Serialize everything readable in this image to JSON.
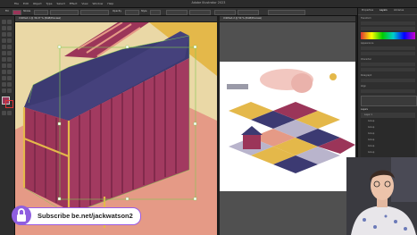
{
  "app": {
    "window_title": "Adobe Illustrator 2023",
    "menus": [
      "File",
      "Edit",
      "Object",
      "Type",
      "Select",
      "Effect",
      "View",
      "Window",
      "Help"
    ]
  },
  "documents": [
    {
      "tab": "Untitled-1 @ 39.27 % (RGB/Preview)"
    },
    {
      "tab": "Untitled-2 @ 50 % (RGB/Preview)"
    }
  ],
  "options_bar": {
    "fill_label": "Fill",
    "stroke_label": "Stroke",
    "opacity_label": "Opacity",
    "style_label": "Style"
  },
  "right_panel": {
    "tabs": [
      "Properties",
      "Layers",
      "Libraries"
    ],
    "sections": [
      "Transform",
      "Appearance",
      "Character",
      "Paragraph",
      "Align"
    ],
    "layers_label": "Layers",
    "layer_names": [
      "Layer 1",
      "Group",
      "Group",
      "Group",
      "Group",
      "Group",
      "Group"
    ]
  },
  "promo": {
    "subscribe": "Subscribe",
    "url": "be.net/jackwatson2"
  },
  "colors": {
    "wine": "#9b3559",
    "navy": "#3c3a72",
    "mustard": "#e4b84a",
    "cream": "#ead8a6",
    "salmon": "#e59a86",
    "selection": "#7ec850",
    "badge": "#8f5fe0"
  },
  "icons": [
    "lock-icon",
    "selection-tool-icon",
    "direct-selection-icon",
    "pen-tool-icon",
    "type-tool-icon",
    "shape-tool-icon",
    "brush-icon",
    "zoom-icon",
    "hand-icon"
  ]
}
